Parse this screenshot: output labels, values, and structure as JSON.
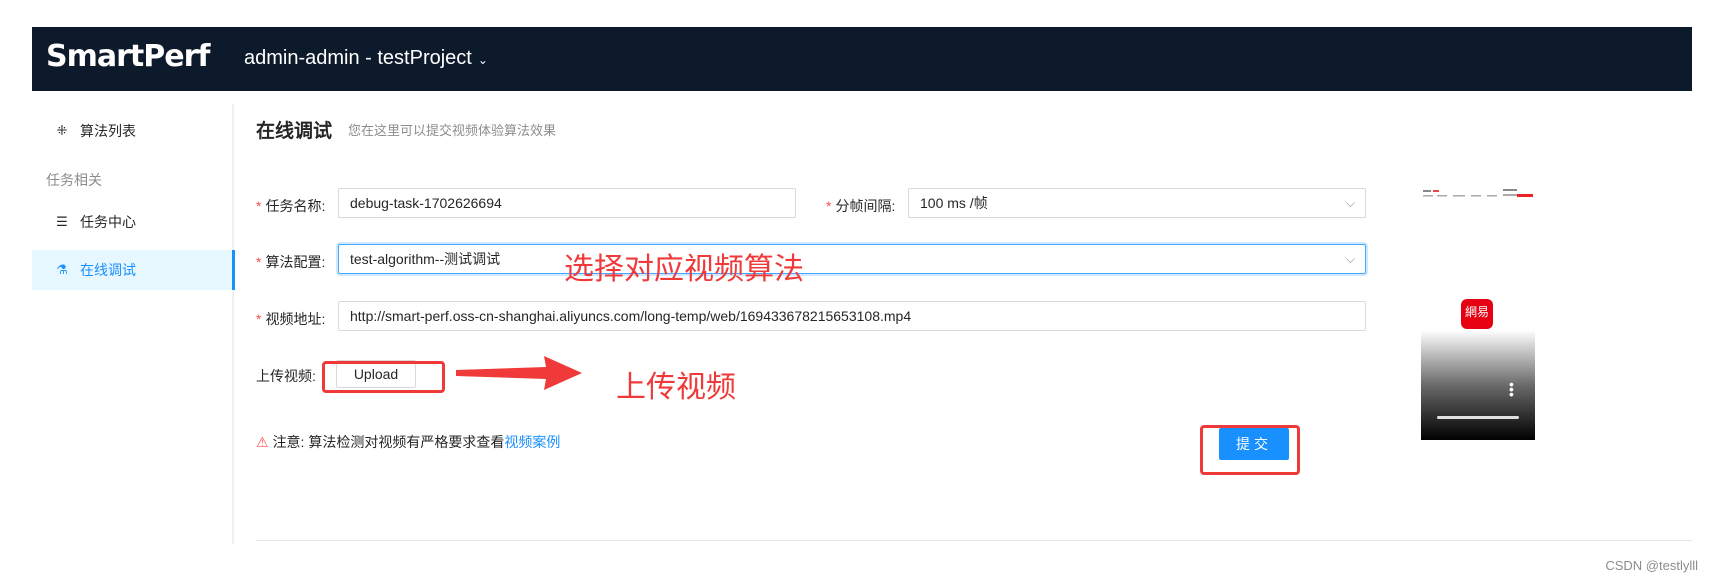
{
  "header": {
    "logo": "SmartPerf",
    "project": "admin-admin - testProject",
    "project_chevron": "⌄"
  },
  "sidebar": {
    "items": [
      {
        "icon": "grid-icon",
        "glyph": "⁜",
        "label": "算法列表"
      },
      {
        "icon": "list-icon",
        "glyph": "☰",
        "label": "任务中心"
      },
      {
        "icon": "flask-icon",
        "glyph": "⚗",
        "label": "在线调试"
      }
    ],
    "group_label": "任务相关",
    "active": "在线调试"
  },
  "page": {
    "title": "在线调试",
    "subtitle": "您在这里可以提交视频体验算法效果"
  },
  "form": {
    "required_mark": "*",
    "task_name_label": "任务名称:",
    "task_name_value": "debug-task-1702626694",
    "interval_label": "分帧间隔:",
    "interval_value": "100 ms /帧",
    "algo_label": "算法配置:",
    "algo_value": "test-algorithm--测试调试",
    "video_label": "视频地址:",
    "video_value": "http://smart-perf.oss-cn-shanghai.aliyuncs.com/long-temp/web/169433678215653108.mp4",
    "upload_label": "上传视频:",
    "upload_button": "Upload",
    "note_prefix": "注意:  算法检测对视频有严格要求查看",
    "note_link": "视频案例",
    "note_icon": "warning-icon",
    "submit": "提交"
  },
  "annotations": {
    "select_hint": "选择对应视频算法",
    "upload_hint": "上传视频",
    "color": "#f03a3a"
  },
  "preview": {
    "app_badge": "網易"
  },
  "watermark": "CSDN @testlylll",
  "colors": {
    "header_bg": "#0d1a2c",
    "primary": "#1890ff",
    "active_bg": "#e6f7ff",
    "required": "#ff4d4f"
  }
}
